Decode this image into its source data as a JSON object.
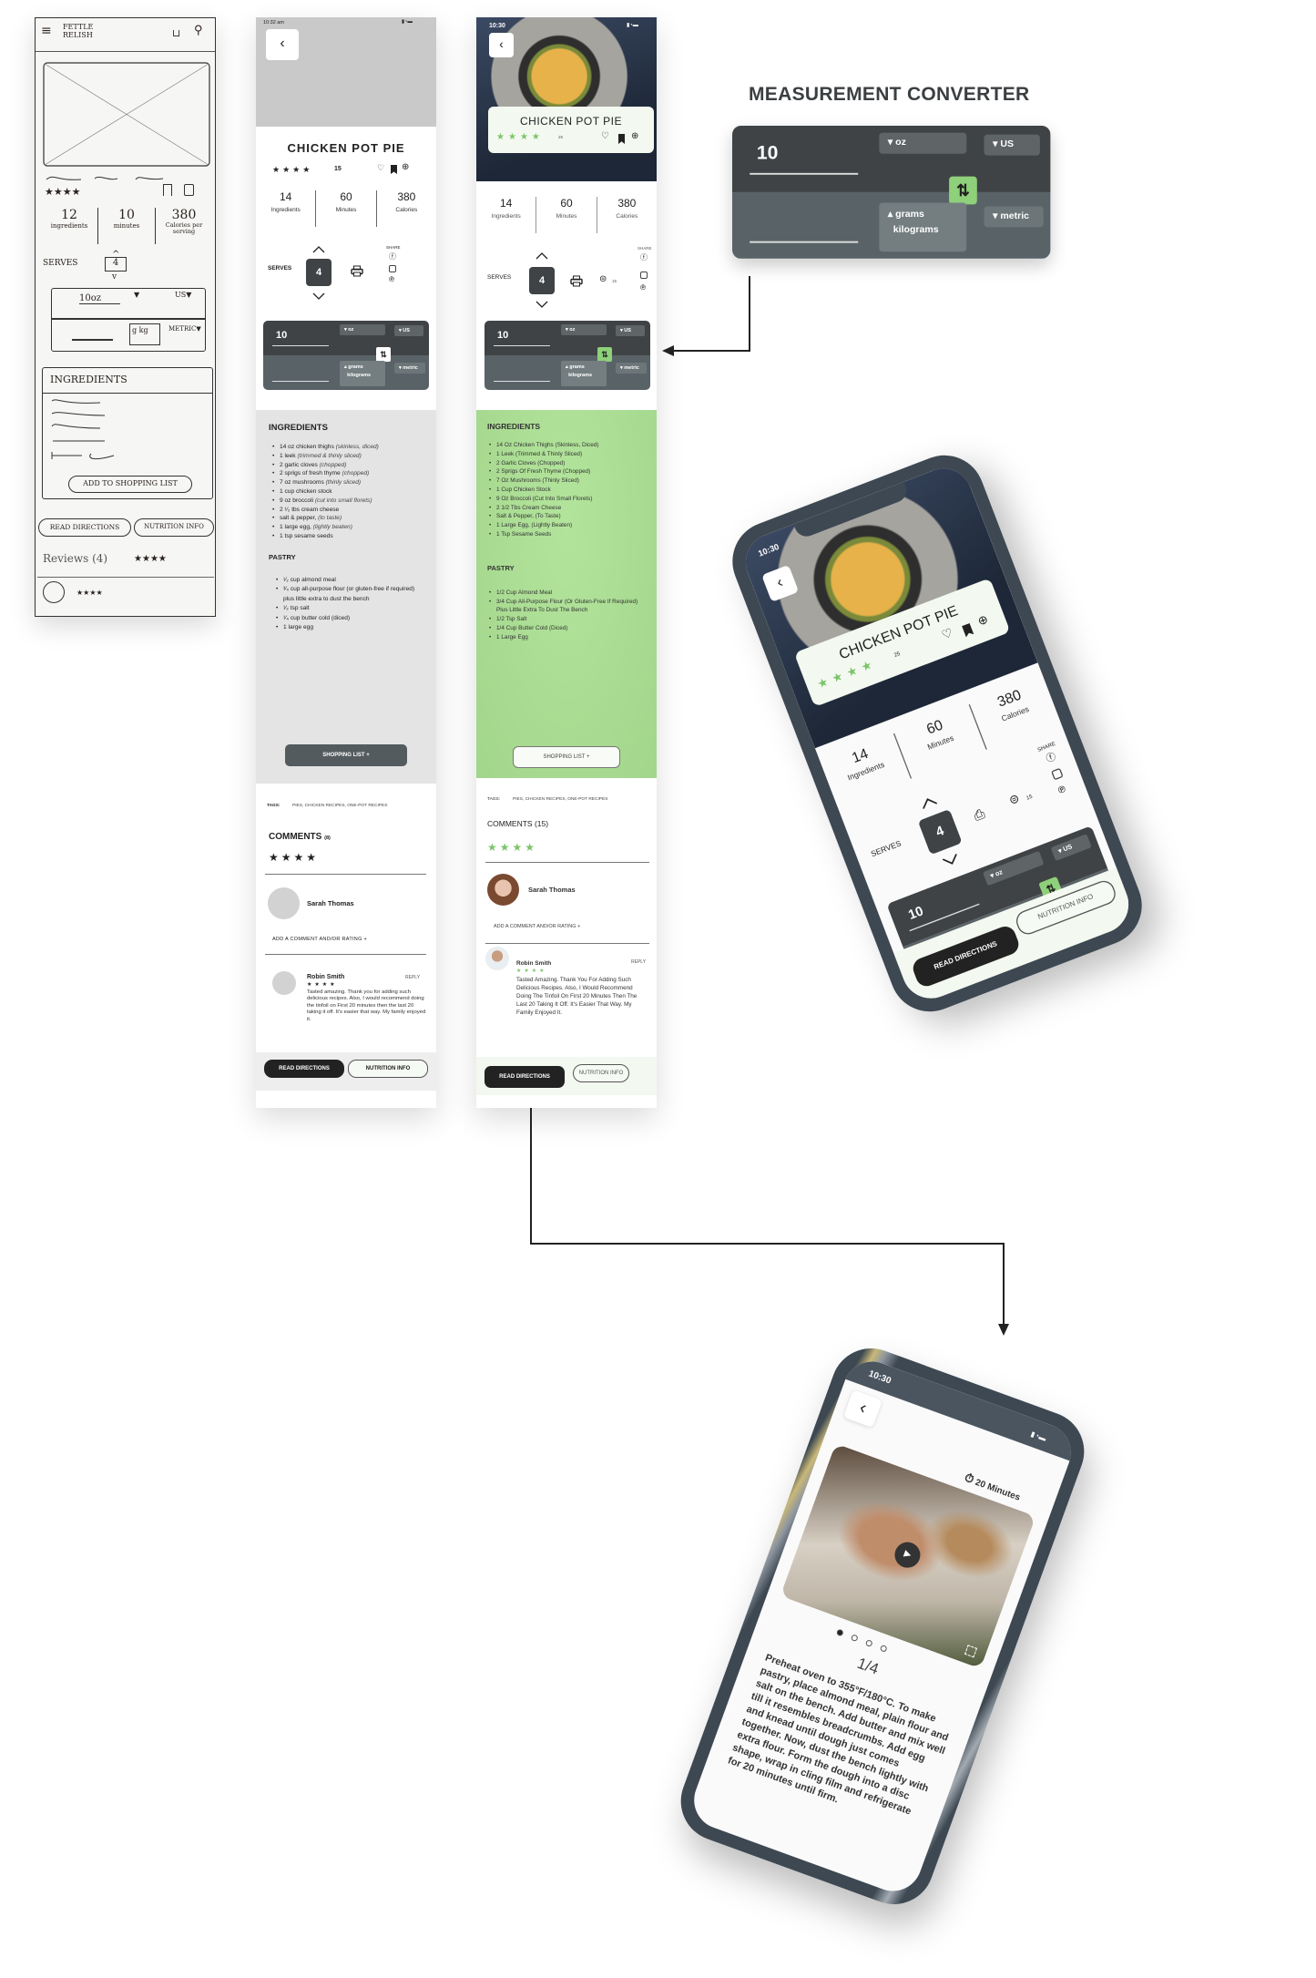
{
  "colors": {
    "accent_green": "#8fd07a",
    "dark": "#3f4345",
    "converter_bottom": "#596367",
    "device": "#3d4852"
  },
  "sketch": {
    "logo": "FETTLE RELISH",
    "stars": 4,
    "stats": [
      {
        "value": "12",
        "label": "ingredients"
      },
      {
        "value": "10",
        "label": "minutes"
      },
      {
        "value": "380",
        "label": "Calories per serving"
      }
    ],
    "serves_label": "SERVES",
    "serves": "4",
    "converter": {
      "value": "10oz",
      "system_top": "US▼",
      "units": "g kg",
      "system_bottom": "METRIC▼"
    },
    "ingredients_title": "INGREDIENTS",
    "shopping_list": "ADD TO SHOPPING LIST",
    "read_directions": "READ DIRECTIONS",
    "nutrition_info": "NUTRITION INFO",
    "reviews": "Reviews (4)"
  },
  "wireframe": {
    "status_time": "10:32 am",
    "title": "CHICKEN POT PIE",
    "stars": 4,
    "rating_count": "15",
    "stats": [
      {
        "value": "14",
        "label": "Ingredients"
      },
      {
        "value": "60",
        "label": "Minutes"
      },
      {
        "value": "380",
        "label": "Calories"
      }
    ],
    "serves_label": "SERVES",
    "serves": "4",
    "share_label": "SHARE",
    "converter": {
      "value": "10",
      "from_unit": "oz",
      "from_system": "US",
      "to_unit": "grams",
      "to_unit_alt": "kilograms",
      "to_system": "metric"
    },
    "ingredients_title": "INGREDIENTS",
    "ingredients": [
      {
        "text": "14  oz chicken thighs ",
        "note": "(skinless, diced)"
      },
      {
        "text": "1 leek ",
        "note": "(trimmed & thinly sliced)"
      },
      {
        "text": "2 garlic cloves ",
        "note": "(chopped)"
      },
      {
        "text": "2 sprigs of fresh thyme ",
        "note": "(chopped)"
      },
      {
        "text": "7 oz mushrooms ",
        "note": "(thinly sliced)"
      },
      {
        "text": "1 cup chicken stock",
        "note": ""
      },
      {
        "text": "9 oz broccoli ",
        "note": "(cut into small florets)"
      },
      {
        "text": "2 ¹⁄₂ tbs cream cheese",
        "note": ""
      },
      {
        "text": "salt & pepper, ",
        "note": "(to taste)"
      },
      {
        "text": "1 large egg, ",
        "note": "(lightly beaten)"
      },
      {
        "text": "1 tsp sesame seeds",
        "note": ""
      }
    ],
    "pastry_title": "PASTRY",
    "pastry": [
      {
        "text": "¹⁄₂ cup almond meal",
        "note": ""
      },
      {
        "text": "³⁄₄ cup all-purpose flour (or gluten-free if required) plus little extra to dust the bench",
        "note": ""
      },
      {
        "text": "¹⁄₂ tsp salt",
        "note": ""
      },
      {
        "text": "¹⁄₄ cup butter cold (diced)",
        "note": ""
      },
      {
        "text": "1 large egg",
        "note": ""
      }
    ],
    "shopping_list": "SHOPPING LIST  +",
    "tags_label": "TAGS:",
    "tags": "PIES, CHICKEN RECIPES, ONE-POT RECIPES",
    "comments_title": "COMMENTS",
    "comments_count": "(8)",
    "comment_stars": 4,
    "current_user": "Sarah Thomas",
    "add_comment": "ADD A COMMENT AND/OR RATING  +",
    "comment": {
      "author": "Robin Smith",
      "reply": "REPLY",
      "stars": 4,
      "text": "Tasted amazing. Thank you for adding such delicious recipes. Also, I would recommend doing the tinfoil on First 20 minutes then the last 20 taking it off. It's easier that way. My family enjoyed it."
    },
    "read_directions": "READ DIRECTIONS",
    "nutrition_info": "NUTRITION INFO"
  },
  "hifi": {
    "status_time": "10:30",
    "title": "CHICKEN POT PIE",
    "stars": 4,
    "rating_count": "25",
    "stats": [
      {
        "value": "14",
        "label": "Ingredients"
      },
      {
        "value": "60",
        "label": "Minutes"
      },
      {
        "value": "380",
        "label": "Calories"
      }
    ],
    "serves_label": "SERVES",
    "serves": "4",
    "share_label": "SHARE",
    "comment_count": "15",
    "converter": {
      "value": "10",
      "from_unit": "oz",
      "from_system": "US",
      "to_unit": "grams",
      "to_unit_alt": "kilograms",
      "to_system": "metric"
    },
    "ingredients_title": "INGREDIENTS",
    "ingredients": [
      {
        "text": "14  Oz Chicken Thighs (Skinless, Diced)",
        "note": ""
      },
      {
        "text": "1 Leek (Trimmed & Thinly Sliced)",
        "note": ""
      },
      {
        "text": "2 Garlic Cloves (Chopped)",
        "note": ""
      },
      {
        "text": "2 Sprigs Of Fresh Thyme (Chopped)",
        "note": ""
      },
      {
        "text": "7 Oz Mushrooms (Thinly Sliced)",
        "note": ""
      },
      {
        "text": "1 Cup Chicken Stock",
        "note": ""
      },
      {
        "text": "9 Oz Broccoli (Cut Into Small Florets)",
        "note": ""
      },
      {
        "text": "2 1/2 Tbs Cream Cheese",
        "note": ""
      },
      {
        "text": "Salt & Pepper, (To Taste)",
        "note": ""
      },
      {
        "text": "1 Large Egg, (Lightly Beaten)",
        "note": ""
      },
      {
        "text": "1 Tsp Sesame Seeds",
        "note": ""
      }
    ],
    "pastry_title": "PASTRY",
    "pastry": [
      {
        "text": "1/2 Cup Almond Meal",
        "note": ""
      },
      {
        "text": "3/4 Cup All-Purpose Flour (Or Gluten-Free If Required) Plus Little Extra To Dust The Bench",
        "note": ""
      },
      {
        "text": "1/2 Tsp Salt",
        "note": ""
      },
      {
        "text": "1/4 Cup Butter Cold (Diced)",
        "note": ""
      },
      {
        "text": "1 Large Egg",
        "note": ""
      }
    ],
    "shopping_list": "SHOPPING LIST  +",
    "tags_label": "TAGS:",
    "tags": "PIES, CHICKEN RECIPES, ONE-POT RECIPES",
    "comments_title": "COMMENTS (15)",
    "comment_stars": 4,
    "current_user": "Sarah Thomas",
    "add_comment": "ADD A COMMENT AND/OR RATING  +",
    "comment": {
      "author": "Robin Smith",
      "reply": "REPLY",
      "stars": 4,
      "text": "Tasted Amazing. Thank You For Adding Such Delicious Recipes. Also, I Would Recommend Doing The Tinfoil On First 20 Minutes Then The Last 20 Taking It Off. It's Easier That Way. My Family Enjoyed It."
    },
    "read_directions": "READ DIRECTIONS",
    "nutrition_info": "NUTRITION INFO"
  },
  "converter_showcase": {
    "title": "MEASUREMENT CONVERTER",
    "value": "10",
    "from_unit": "oz",
    "from_system": "US",
    "to_unit": "grams",
    "to_unit_alt": "kilograms",
    "to_system": "metric"
  },
  "directions_screen": {
    "status_time": "10:30",
    "timer": "20 Minutes",
    "step": "1/4",
    "current_step": 1,
    "total_steps": 4,
    "text": "Preheat oven to 355°F/180°C. To make pastry, place almond meal, plain flour and salt on the bench. Add butter and mix well till it resembles breadcrumbs. Add egg and knead until dough just comes together. Now, dust the bench lightly with extra flour. Form the dough into a disc shape, wrap in cling film and refrigerate for 20 minutes until firm."
  }
}
